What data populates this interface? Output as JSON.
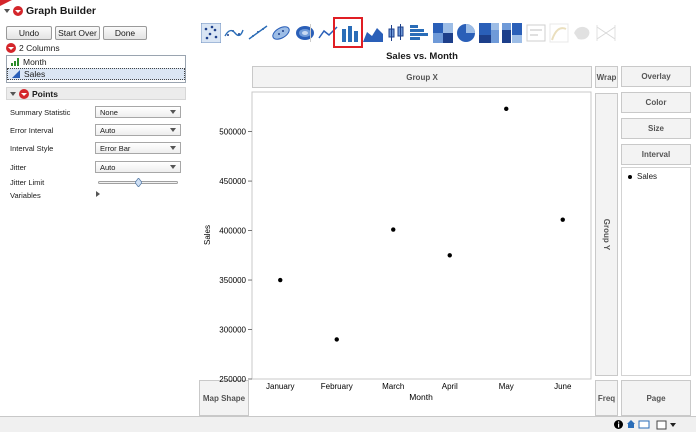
{
  "window": {
    "title": "Graph Builder"
  },
  "toolbar": {
    "undo": "Undo",
    "start_over": "Start Over",
    "done": "Done"
  },
  "columns": {
    "header": "2 Columns",
    "items": [
      "Month",
      "Sales"
    ]
  },
  "points_panel": {
    "title": "Points",
    "rows": [
      {
        "label": "Summary Statistic",
        "value": "None"
      },
      {
        "label": "Error Interval",
        "value": "Auto"
      },
      {
        "label": "Interval Style",
        "value": "Error Bar"
      },
      {
        "label": "Jitter",
        "value": "Auto"
      }
    ],
    "jitter_limit_label": "Jitter Limit",
    "variables_label": "Variables"
  },
  "element_icons": [
    "points-icon",
    "smoother-icon",
    "line-of-fit-icon",
    "ellipse-icon",
    "contour-icon",
    "line-icon",
    "bar-icon",
    "area-icon",
    "box-plot-icon",
    "histogram-icon",
    "heatmap-icon",
    "pie-icon",
    "treemap-icon",
    "mosaic-icon",
    "caption-box-icon",
    "formula-icon",
    "map-shapes-icon",
    "parallel-icon"
  ],
  "highlight_color": "#e01e24",
  "zones": {
    "group_x": "Group X",
    "group_y": "Group Y",
    "wrap": "Wrap",
    "overlay": "Overlay",
    "color": "Color",
    "size": "Size",
    "interval": "Interval",
    "map_shape": "Map Shape",
    "freq": "Freq",
    "page": "Page"
  },
  "legend": {
    "items": [
      "Sales"
    ]
  },
  "chart_data": {
    "type": "scatter",
    "title": "Sales vs. Month",
    "xlabel": "Month",
    "ylabel": "Sales",
    "categories": [
      "January",
      "February",
      "March",
      "April",
      "May",
      "June"
    ],
    "values": [
      350000,
      290000,
      401000,
      375000,
      523000,
      411000
    ],
    "ylim": [
      250000,
      540000
    ],
    "yticks": [
      "500000",
      "450000",
      "400000",
      "350000",
      "300000",
      "250000"
    ],
    "ytick_values": [
      500000,
      450000,
      400000,
      350000,
      300000,
      250000
    ],
    "grid": false
  }
}
